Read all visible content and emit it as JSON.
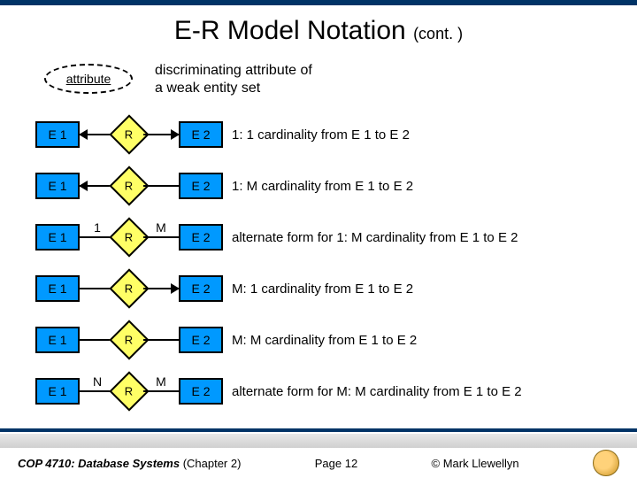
{
  "title": {
    "main": "E-R Model Notation",
    "cont": "(cont. )"
  },
  "discrim": {
    "label": "attribute",
    "text_line1": "discriminating attribute of",
    "text_line2": "a weak entity set"
  },
  "rows": [
    {
      "e1": "E 1",
      "l_label": "",
      "r": "R",
      "r_label": "",
      "e2": "E 2",
      "desc": "1: 1 cardinality from E 1 to E 2",
      "left_arrow": true,
      "right_arrow": true
    },
    {
      "e1": "E 1",
      "l_label": "",
      "r": "R",
      "r_label": "",
      "e2": "E 2",
      "desc": "1: M cardinality from E 1 to E 2",
      "left_arrow": true,
      "right_arrow": false
    },
    {
      "e1": "E 1",
      "l_label": "1",
      "r": "R",
      "r_label": "M",
      "e2": "E 2",
      "desc": "alternate form for 1: M cardinality from E 1 to E 2",
      "left_arrow": false,
      "right_arrow": false
    },
    {
      "e1": "E 1",
      "l_label": "",
      "r": "R",
      "r_label": "",
      "e2": "E 2",
      "desc": "M: 1 cardinality from E 1 to E 2",
      "left_arrow": false,
      "right_arrow": true
    },
    {
      "e1": "E 1",
      "l_label": "",
      "r": "R",
      "r_label": "",
      "e2": "E 2",
      "desc": "M: M cardinality from E 1 to E 2",
      "left_arrow": false,
      "right_arrow": false
    },
    {
      "e1": "E 1",
      "l_label": "N",
      "r": "R",
      "r_label": "M",
      "e2": "E 2",
      "desc": "alternate form for M: M cardinality from E 1 to E 2",
      "left_arrow": false,
      "right_arrow": false
    }
  ],
  "footer": {
    "course": "COP 4710: Database Systems",
    "chapter": "(Chapter 2)",
    "page": "Page 12",
    "author": "© Mark Llewellyn"
  }
}
